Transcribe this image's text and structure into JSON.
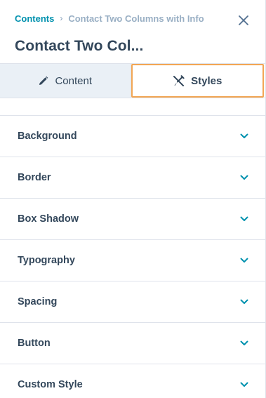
{
  "header": {
    "breadcrumb_root": "Contents",
    "breadcrumb_separator": "›",
    "breadcrumb_current": "Contact Two Columns with Info",
    "title": "Contact Two Col..."
  },
  "tabs": [
    {
      "label": "Content",
      "icon": "pencil-icon",
      "active": false
    },
    {
      "label": "Styles",
      "icon": "brush-tools-icon",
      "active": true
    }
  ],
  "sections": [
    {
      "label": "Background"
    },
    {
      "label": "Border"
    },
    {
      "label": "Box Shadow"
    },
    {
      "label": "Typography"
    },
    {
      "label": "Spacing"
    },
    {
      "label": "Button"
    },
    {
      "label": "Custom Style"
    }
  ],
  "colors": {
    "accent": "#0091ae",
    "active_tab_outline": "#f2a654",
    "text": "#33475b"
  }
}
